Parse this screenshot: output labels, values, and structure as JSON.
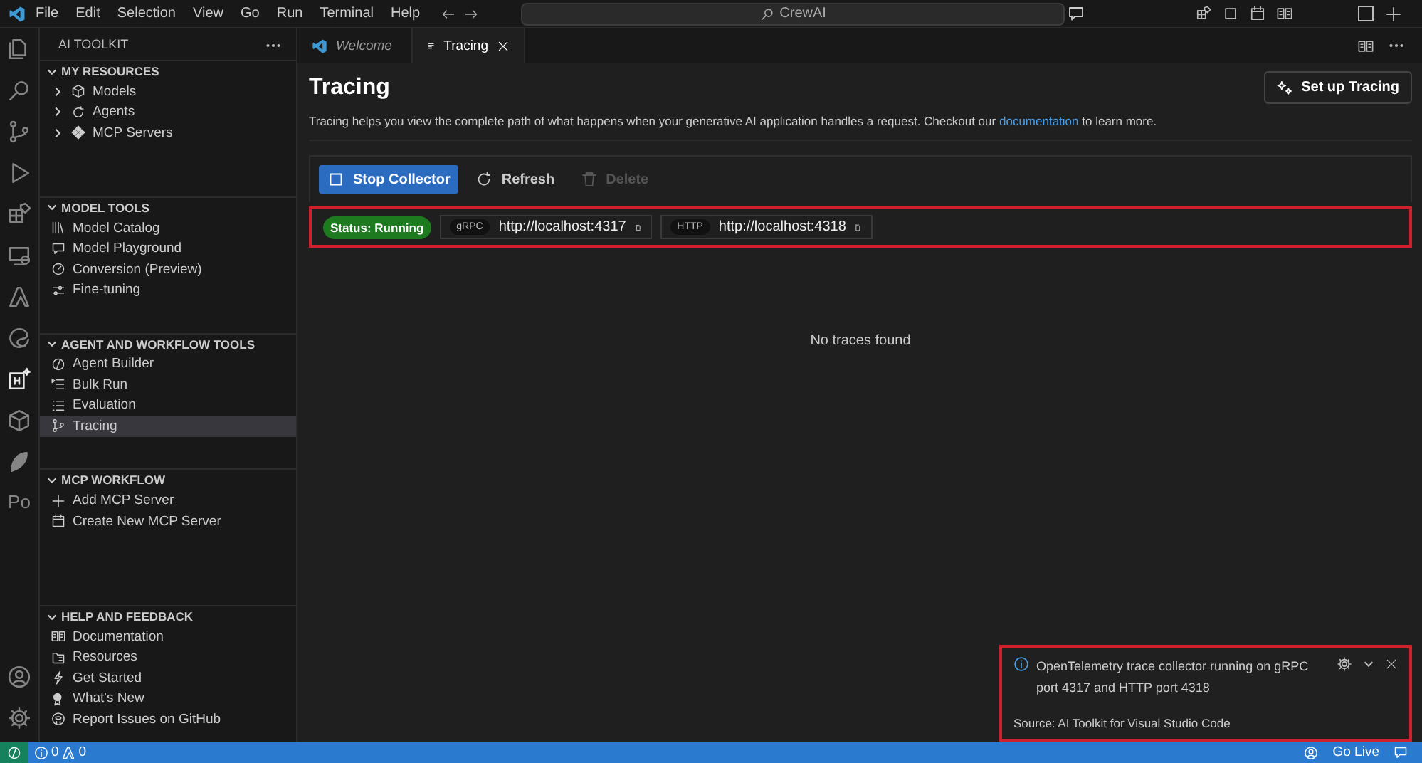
{
  "menu": [
    "File",
    "Edit",
    "Selection",
    "View",
    "Go",
    "Run",
    "Terminal",
    "Help"
  ],
  "command_center": "CrewAI",
  "activity_bar": [
    {
      "kind": "files",
      "selected": false
    },
    {
      "kind": "search",
      "selected": false
    },
    {
      "kind": "branch",
      "selected": false
    },
    {
      "kind": "run",
      "selected": false
    },
    {
      "kind": "blocks",
      "selected": false
    },
    {
      "kind": "monitor",
      "selected": false
    },
    {
      "kind": "peak",
      "selected": false
    },
    {
      "kind": "swirl",
      "selected": false
    },
    {
      "kind": "toolkit",
      "selected": true
    },
    {
      "kind": "cube",
      "selected": false
    },
    {
      "kind": "leaf",
      "selected": false
    },
    {
      "kind": "text",
      "text": "Po",
      "selected": false
    }
  ],
  "sidebar": {
    "title": "AI TOOLKIT",
    "sections": [
      {
        "title": "MY RESOURCES",
        "expanded": true,
        "items": [
          {
            "label": "Models",
            "expanded": false,
            "selected": false
          },
          {
            "label": "Agents",
            "expanded": false,
            "selected": false
          },
          {
            "label": "MCP Servers",
            "expanded": false,
            "selected": false
          }
        ]
      },
      {
        "title": "MODEL TOOLS",
        "expanded": true,
        "items": [
          {
            "label": "Model Catalog",
            "selected": false
          },
          {
            "label": "Model Playground",
            "selected": false
          },
          {
            "label": "Conversion (Preview)",
            "selected": false
          },
          {
            "label": "Fine-tuning",
            "selected": false
          }
        ]
      },
      {
        "title": "AGENT AND WORKFLOW TOOLS",
        "expanded": true,
        "items": [
          {
            "label": "Agent Builder",
            "selected": false
          },
          {
            "label": "Bulk Run",
            "selected": false
          },
          {
            "label": "Evaluation",
            "selected": false
          },
          {
            "label": "Tracing",
            "selected": true
          }
        ]
      },
      {
        "title": "MCP WORKFLOW",
        "expanded": true,
        "items": [
          {
            "label": "Add MCP Server",
            "selected": false
          },
          {
            "label": "Create New MCP Server",
            "selected": false
          }
        ]
      },
      {
        "title": "HELP AND FEEDBACK",
        "expanded": true,
        "items": [
          {
            "label": "Documentation",
            "selected": false
          },
          {
            "label": "Resources",
            "selected": false
          },
          {
            "label": "Get Started",
            "selected": false
          },
          {
            "label": "What's New",
            "selected": false
          },
          {
            "label": "Report Issues on GitHub",
            "selected": false
          }
        ]
      }
    ]
  },
  "tabs": [
    {
      "label": "Welcome",
      "preview": true,
      "selected": false
    },
    {
      "label": "Tracing",
      "preview": false,
      "selected": true
    }
  ],
  "page": {
    "title": "Tracing",
    "setup_button": "Set up Tracing",
    "description": {
      "before": "Tracing helps you view the complete path of what happens when your generative AI application handles a request. Checkout our",
      "link": "documentation",
      "after": "to learn more."
    },
    "toolbar": [
      {
        "label": "Stop Collector",
        "kind": "primary",
        "disabled": false
      },
      {
        "label": "Refresh",
        "kind": "refresh",
        "disabled": false
      },
      {
        "label": "Delete",
        "kind": "delete",
        "disabled": true
      }
    ],
    "endpoints": {
      "highlighted": true,
      "status": "Status: Running",
      "items": [
        {
          "protocol": "gRPC",
          "url": "http://localhost:4317"
        },
        {
          "protocol": "HTTP",
          "url": "http://localhost:4318"
        }
      ]
    },
    "empty_message": "No traces found"
  },
  "notification": {
    "highlighted": true,
    "message": "OpenTelemetry trace collector running on gRPC port 4317 and HTTP port 4318",
    "source": "Source: AI Toolkit for Visual Studio Code"
  },
  "status_bar": {
    "errors": "0",
    "warnings": "0",
    "go_live": "Go Live"
  }
}
